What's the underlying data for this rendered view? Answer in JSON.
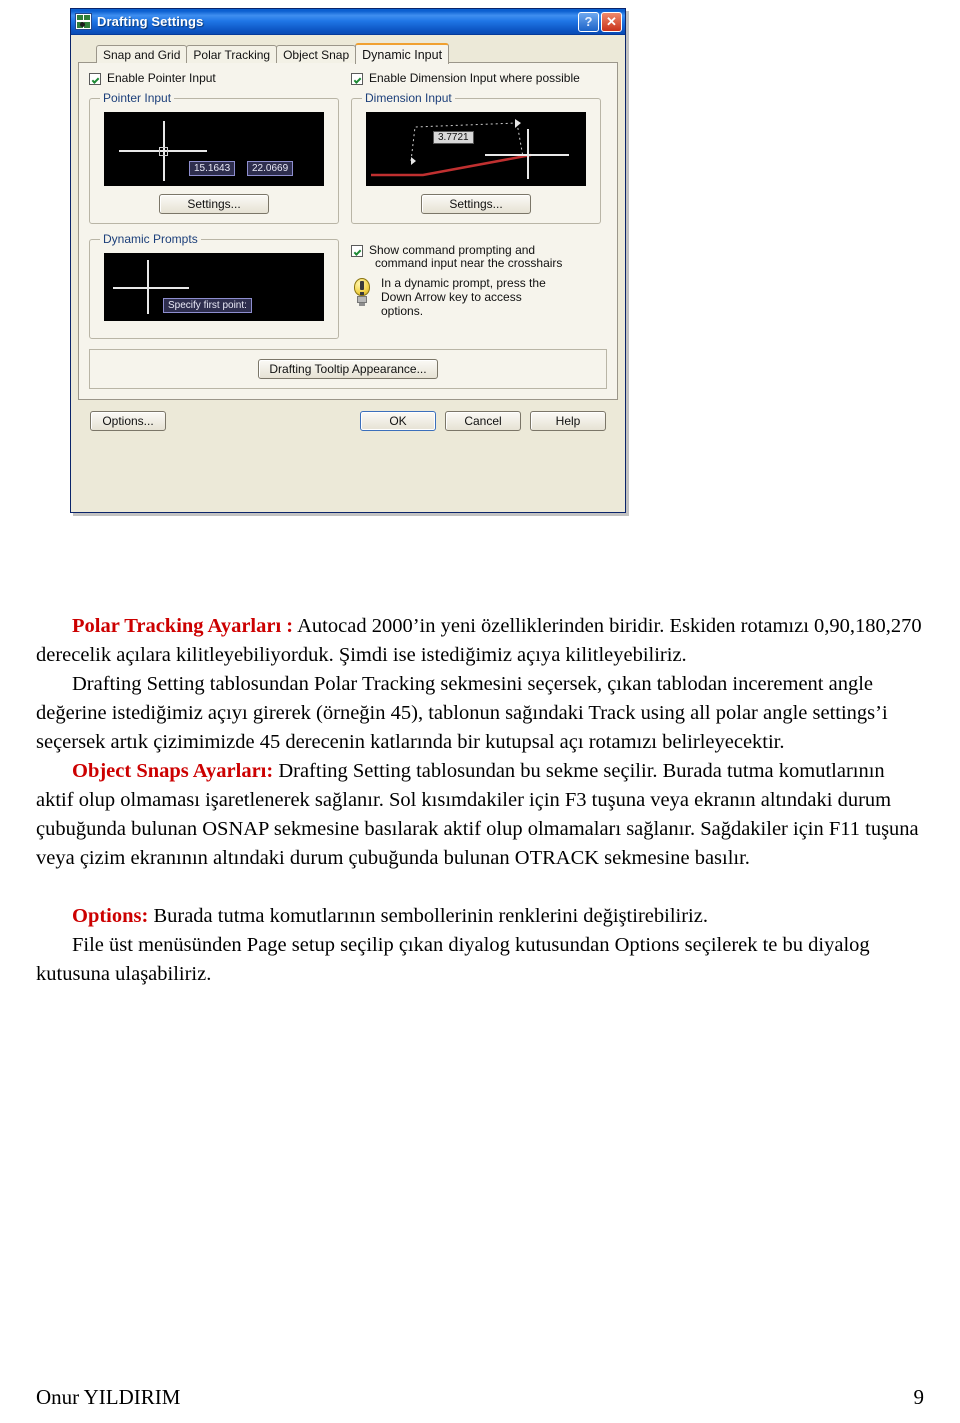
{
  "dialog": {
    "title": "Drafting Settings",
    "icon": "autocad-app-icon",
    "titlebar_buttons": [
      {
        "name": "help-button",
        "glyph": "?"
      },
      {
        "name": "close-button",
        "glyph": "✕"
      }
    ],
    "tabs": [
      {
        "label": "Snap and Grid",
        "active": false
      },
      {
        "label": "Polar Tracking",
        "active": false
      },
      {
        "label": "Object Snap",
        "active": false
      },
      {
        "label": "Dynamic Input",
        "active": true
      }
    ],
    "pointer": {
      "enable_label": "Enable Pointer Input",
      "enable_checked": true,
      "group_label": "Pointer Input",
      "preview_value_x": "15.1643",
      "preview_value_y": "22.0669",
      "settings_label": "Settings..."
    },
    "dimension": {
      "enable_label": "Enable Dimension Input where possible",
      "enable_checked": true,
      "group_label": "Dimension Input",
      "preview_value": "3.7721",
      "settings_label": "Settings..."
    },
    "prompts": {
      "group_label": "Dynamic Prompts",
      "preview_prompt": "Specify first point:",
      "show_label_line1": "Show command prompting and",
      "show_label_line2": "command input near the crosshairs",
      "show_checked": true,
      "tip_line1": "In a dynamic prompt, press the",
      "tip_line2": "Down Arrow key to access",
      "tip_line3": "options."
    },
    "tooltip_appearance_label": "Drafting Tooltip Appearance...",
    "footer_buttons": {
      "options": "Options...",
      "ok": "OK",
      "cancel": "Cancel",
      "help": "Help"
    },
    "colors": {
      "titlebar_blue": "#0b5fd0",
      "dialog_face": "#ece9d8",
      "tab_accent_orange": "#f0a030",
      "preview_black": "#000000",
      "tooltip_navy": "#2e2e4e",
      "dimension_red": "#c00000"
    }
  },
  "document": {
    "paragraphs": [
      {
        "id": "polar-tracking",
        "heading": "Polar Tracking Ayarları :",
        "body": " Autocad 2000’in yeni özelliklerinden biridir. Eskiden rotamızı 0,90,180,270 derecelik açılara kilitleyebiliyorduk. Şimdi ise istediğimiz açıya kilitleyebiliriz."
      },
      {
        "id": "drafting-setting",
        "heading": "",
        "body": "Drafting Setting tablosundan Polar Tracking sekmesini seçersek, çıkan tablodan incerement angle değerine istediğimiz açıyı girerek (örneğin 45), tablonun sağındaki Track using all polar angle settings’i seçersek artık çizimimizde  45 derecenin katlarında bir kutupsal açı rotamızı belirleyecektir."
      },
      {
        "id": "object-snaps",
        "heading": "Object Snaps Ayarları:",
        "body": " Drafting Setting tablosundan bu sekme seçilir. Burada tutma komutlarının aktif olup olmaması işaretlenerek sağlanır. Sol kısımdakiler için F3 tuşuna veya ekranın altındaki durum çubuğunda bulunan OSNAP sekmesine basılarak aktif olup olmamaları sağlanır. Sağdakiler için F11 tuşuna veya çizim ekranının altındaki durum çubuğunda bulunan OTRACK sekmesine basılır."
      },
      {
        "id": "options",
        "heading": "Options:",
        "body": " Burada tutma komutlarının sembollerinin renklerini değiştirebiliriz."
      },
      {
        "id": "file-page-setup",
        "heading": "",
        "body": "File üst menüsünden Page setup seçilip çıkan diyalog kutusundan Options seçilerek te bu diyalog kutusuna ulaşabiliriz."
      }
    ],
    "heading_color": "#cc0000"
  },
  "page_footer": {
    "author": "Onur YILDIRIM",
    "page_number": "9"
  }
}
